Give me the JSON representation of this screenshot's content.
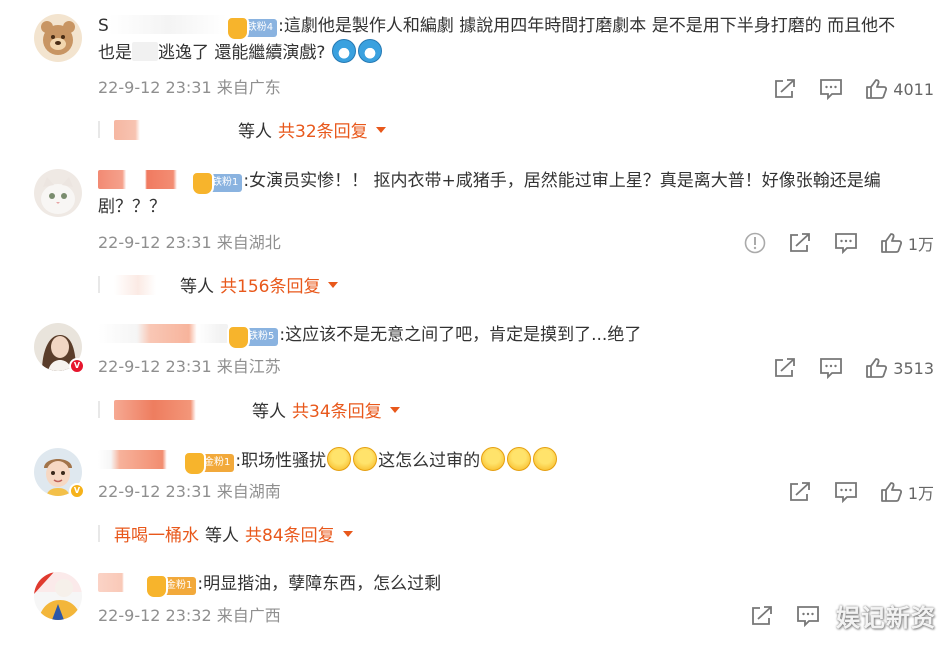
{
  "comments": [
    {
      "username": "S",
      "fan_badge": "铁粉4",
      "text_a": ":這劇他是製作人和編劇 據說用四年時間打磨劇本 是不是用下半身打磨的 而且他不",
      "text_b_pre": "也是",
      "text_b_post": "逃逸了 還能繼續演戲?",
      "timestamp": "22-9-12 23:31",
      "location": "来自广东",
      "likes": "4011",
      "reply_others": "等人",
      "reply_count": "共32条回复"
    },
    {
      "fan_badge": "铁粉1",
      "text": ":女演员实惨！！ 抠内衣带+咸猪手，居然能过审上星？真是离大普！好像张翰还是编剧？？？",
      "timestamp": "22-9-12 23:31",
      "location": "来自湖北",
      "likes": "1万",
      "reply_others": "等人",
      "reply_count": "共156条回复"
    },
    {
      "fan_badge": "铁粉5",
      "text": ":这应该不是无意之间了吧，肯定是摸到了...绝了",
      "timestamp": "22-9-12 23:31",
      "location": "来自江苏",
      "likes": "3513",
      "reply_others": "等人",
      "reply_count": "共34条回复"
    },
    {
      "fan_badge": "金粉1",
      "text_pre": ":职场性骚扰",
      "text_mid": "这怎么过审的",
      "timestamp": "22-9-12 23:31",
      "location": "来自湖南",
      "likes": "1万",
      "reply_name": "再喝一桶水",
      "reply_others": "等人",
      "reply_count": "共84条回复"
    },
    {
      "fan_badge": "金粉1",
      "text": ":明显揩油，孽障东西，怎么过剩",
      "timestamp": "22-9-12 23:32",
      "location": "来自广西"
    }
  ],
  "icons": {
    "share": "share-icon",
    "comment": "comment-icon",
    "like": "like-icon",
    "report": "report-icon"
  },
  "colors": {
    "accent": "#e8581b",
    "meta": "#8f8f8f",
    "fan_iron": "#8ab3e0",
    "fan_gold": "#f2a93b"
  },
  "watermark": "娱记新资"
}
